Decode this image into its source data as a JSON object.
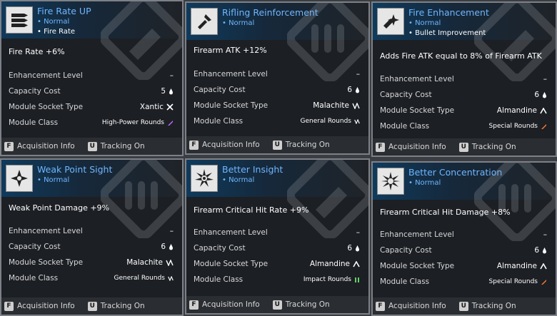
{
  "labels": {
    "enhancement_level": "Enhancement Level",
    "capacity_cost": "Capacity Cost",
    "module_socket_type": "Module Socket Type",
    "module_class": "Module Class"
  },
  "footer": {
    "acquisition_key": "F",
    "acquisition_label": "Acquisition Info",
    "tracking_key": "U",
    "tracking_label": "Tracking On"
  },
  "colors": {
    "name": "#6fb6ff",
    "high_power": "#c36bff",
    "general": "#ffffff",
    "special": "#ff7a2e",
    "impact": "#5fd35f"
  },
  "cards": [
    {
      "name": "Fire Rate UP",
      "grade": "• Normal",
      "extra": "• Fire Rate",
      "effect": "Fire Rate +6%",
      "level": "–",
      "cost": "5",
      "socket": "Xantic",
      "socket_icon": "xantic-socket-icon",
      "class": "High-Power Rounds",
      "class_icon": "high-power-rounds-icon"
    },
    {
      "name": "Rifling Reinforcement",
      "grade": "• Normal",
      "extra": "",
      "effect": "Firearm ATK +12%",
      "level": "–",
      "cost": "6",
      "socket": "Malachite",
      "socket_icon": "malachite-socket-icon",
      "class": "General Rounds",
      "class_icon": "general-rounds-icon"
    },
    {
      "name": "Fire Enhancement",
      "grade": "• Normal",
      "extra": "• Bullet Improvement",
      "effect": "Adds Fire ATK equal to 8% of Firearm ATK",
      "level": "–",
      "cost": "6",
      "socket": "Almandine",
      "socket_icon": "almandine-socket-icon",
      "class": "Special Rounds",
      "class_icon": "special-rounds-icon"
    },
    {
      "name": "Weak Point Sight",
      "grade": "• Normal",
      "extra": "",
      "effect": "Weak Point Damage +9%",
      "level": "–",
      "cost": "6",
      "socket": "Malachite",
      "socket_icon": "malachite-socket-icon",
      "class": "General Rounds",
      "class_icon": "general-rounds-icon"
    },
    {
      "name": "Better Insight",
      "grade": "• Normal",
      "extra": "",
      "effect": "Firearm Critical Hit Rate +9%",
      "level": "–",
      "cost": "6",
      "socket": "Almandine",
      "socket_icon": "almandine-socket-icon",
      "class": "Impact Rounds",
      "class_icon": "impact-rounds-icon"
    },
    {
      "name": "Better Concentration",
      "grade": "• Normal",
      "extra": "",
      "effect": "Firearm Critical Hit Damage +8%",
      "level": "–",
      "cost": "6",
      "socket": "Almandine",
      "socket_icon": "almandine-socket-icon",
      "class": "Special Rounds",
      "class_icon": "special-rounds-icon"
    }
  ]
}
